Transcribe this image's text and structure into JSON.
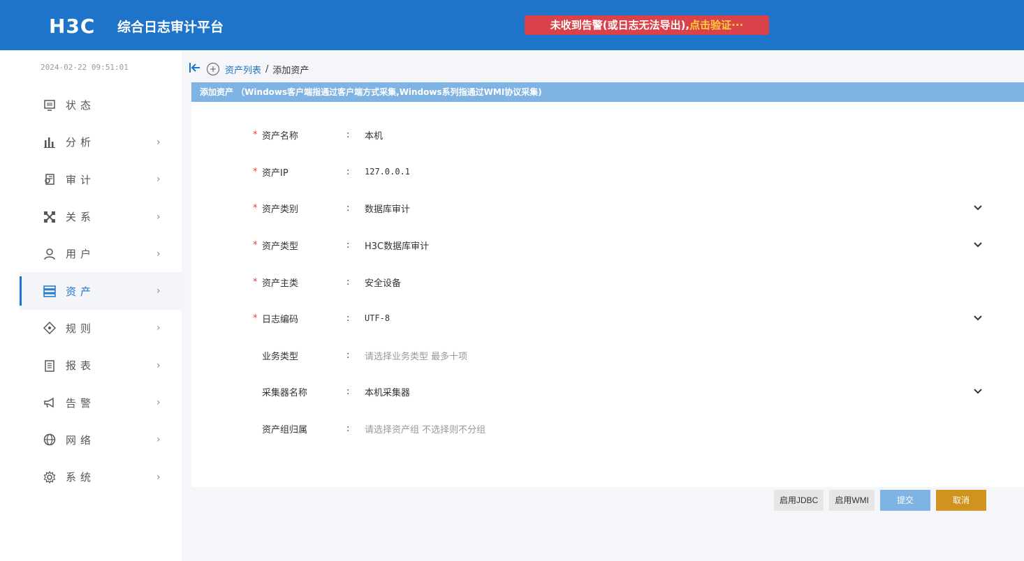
{
  "header": {
    "logo": "H3C",
    "title": "综合日志审计平台",
    "alert_text": "未收到告警(或日志无法导出),",
    "alert_link": "点击验证···"
  },
  "sidebar": {
    "datetime": "2024-02-22 09:51:01",
    "items": [
      {
        "label": "状态",
        "icon": "monitor-icon",
        "arrow": ""
      },
      {
        "label": "分析",
        "icon": "bar-chart-icon",
        "arrow": "›"
      },
      {
        "label": "审计",
        "icon": "audit-icon",
        "arrow": "›"
      },
      {
        "label": "关系",
        "icon": "relation-icon",
        "arrow": "›"
      },
      {
        "label": "用户",
        "icon": "user-icon",
        "arrow": "›"
      },
      {
        "label": "资产",
        "icon": "server-icon",
        "arrow": "›"
      },
      {
        "label": "规则",
        "icon": "diamond-icon",
        "arrow": "›"
      },
      {
        "label": "报表",
        "icon": "report-icon",
        "arrow": "›"
      },
      {
        "label": "告警",
        "icon": "megaphone-icon",
        "arrow": "›"
      },
      {
        "label": "网络",
        "icon": "globe-icon",
        "arrow": "›"
      },
      {
        "label": "系统",
        "icon": "gear-icon",
        "arrow": "›"
      }
    ]
  },
  "breadcrumb": {
    "parent": "资产列表",
    "separator": "/",
    "current": "添加资产"
  },
  "panel": {
    "title": "添加资产 （Windows客户端指通过客户端方式采集,Windows系列指通过WMI协议采集)"
  },
  "form": {
    "colon": ":",
    "asset_name": {
      "label": "资产名称",
      "value": "本机"
    },
    "asset_ip": {
      "label": "资产IP",
      "value": "127.0.0.1"
    },
    "asset_category": {
      "label": "资产类别",
      "value": "数据库审计"
    },
    "asset_type": {
      "label": "资产类型",
      "value": "H3C数据库审计"
    },
    "asset_main_class": {
      "label": "资产主类",
      "value": "安全设备"
    },
    "log_encoding": {
      "label": "日志编码",
      "value": "UTF-8"
    },
    "business_type": {
      "label": "业务类型",
      "placeholder": "请选择业务类型 最多十项"
    },
    "collector_name": {
      "label": "采集器名称",
      "value": "本机采集器"
    },
    "asset_group": {
      "label": "资产组归属",
      "placeholder": "请选择资产组 不选择则不分组"
    }
  },
  "buttons": {
    "jdbc": "启用JDBC",
    "wmi": "启用WMI",
    "submit": "提交",
    "cancel": "取消"
  },
  "colors": {
    "header_bg": "#1e74c8",
    "alert_bg": "#d9424a",
    "panel_head": "#7fb3e3",
    "submit": "#7fb3e3",
    "cancel": "#d19320",
    "required": "#e04040"
  }
}
